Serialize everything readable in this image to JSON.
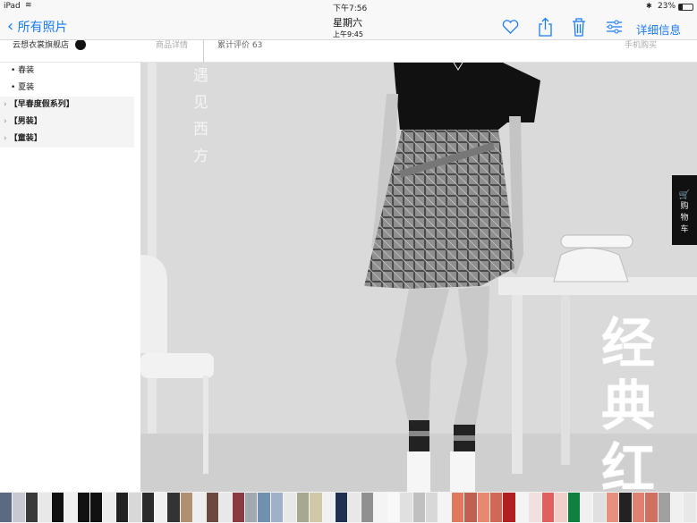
{
  "status_bar": {
    "device": "iPad",
    "time": "下午7:56",
    "battery": "23%"
  },
  "nav": {
    "back_label": "所有照片",
    "title": "星期六",
    "subtitle": "上午9:45",
    "info_label": "详细信息",
    "icons": [
      "heart-icon",
      "share-icon",
      "trash-icon",
      "adjust-icon"
    ]
  },
  "page": {
    "shop_name": "云想衣裳旗舰店",
    "tab_details": "商品详情",
    "tab_reviews": "累计评价 63",
    "mobile_buy": "手机购买"
  },
  "sidebar": {
    "items": [
      {
        "label": "• 春装",
        "type": "sub"
      },
      {
        "label": "• 夏装",
        "type": "sub"
      },
      {
        "label": "【早春度假系列】",
        "type": "cat"
      },
      {
        "label": "【男装】",
        "type": "cat"
      },
      {
        "label": "【童装】",
        "type": "cat"
      }
    ]
  },
  "photo": {
    "vertical_text": "遇见西方",
    "calligraphy": "经典红",
    "cart_label": "购物车",
    "colors": {
      "background": "#dcdcdc",
      "top": "#111111",
      "skirt": "#8a8a8a"
    }
  },
  "thumbnails": [
    "#5a6a80",
    "#c8c8d0",
    "#3a3a3a",
    "#e8e8e8",
    "#111111",
    "#f0f0f0",
    "#111111",
    "#111111",
    "#ececec",
    "#222222",
    "#d8d8d8",
    "#2a2a2a",
    "#f0f0f0",
    "#333333",
    "#b09070",
    "#eeeeee",
    "#6a4a40",
    "#e8e8e8",
    "#8a3a40",
    "#a0a8b0",
    "#7090b0",
    "#a0b0c8",
    "#e8e8e8",
    "#a8a890",
    "#d0c8a8",
    "#f0f0f0",
    "#203050",
    "#e8e8e8",
    "#909090",
    "#f4f4f4",
    "#f8f8f8",
    "#e0e0e0",
    "#c0c0c0",
    "#d8d8d8",
    "#f4f4f4",
    "#e07860",
    "#c06050",
    "#e88870",
    "#d06858",
    "#b02020",
    "#f4f4f4",
    "#f0e0e0",
    "#e06060",
    "#f0d0c8",
    "#108040",
    "#f0f0f0",
    "#e0e0e0",
    "#e89080",
    "#222222",
    "#e08070",
    "#d07060",
    "#a0a0a0",
    "#f0f0f0",
    "#e8e8e8"
  ]
}
